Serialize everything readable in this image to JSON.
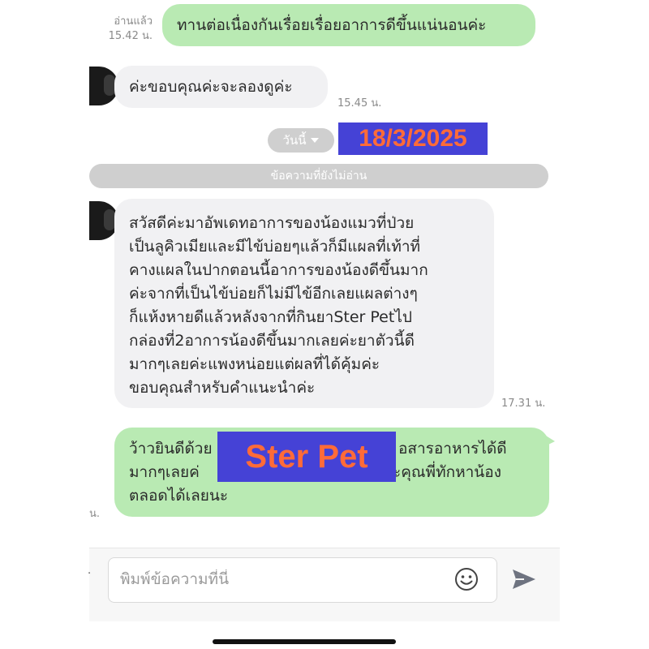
{
  "messages": {
    "m1": {
      "read_label": "อ่านแล้ว",
      "time": "15.42 น.",
      "text": "ทานต่อเนื่องกันเรื่อยเรื่อยอาการดีขึ้นแน่นอนค่ะ"
    },
    "m2": {
      "time": "15.45 น.",
      "text": "ค่ะขอบคุณค่ะจะลองดูค่ะ"
    },
    "m3": {
      "time": "17.31 น.",
      "lines": [
        "สวัสดีค่ะมาอัพเดทอาการของน้องแมวที่ป่วย",
        "เป็นลูคิวเมียและมีไข้บ่อยๆแล้วก็มีแผลที่เท้าที่",
        "คางแผลในปากตอนนี้อาการของน้องดีขึ้นมาก",
        "ค่ะจากที่เป็นไข้บ่อยก็ไม่มีไข้อีกเลยแผลต่างๆ",
        "ก็แห้งหายดีแล้วหลังจากที่กินยาSter  Petไป",
        "กล่องที่2อาการน้องดีขึ้นมากเลยค่ะยาตัวนี้ดี",
        "มากๆเลยค่ะแพงหน่อยแต่ผลที่ได้คุ้มค่ะ",
        "ขอบคุณสำหรับคำแนะนำค่ะ"
      ]
    },
    "m4": {
      "line1_left": "ว้าวยินดีด้วย",
      "line1_right": "อสารอาหารได้ดี",
      "line2_left": "มากๆเลยค่",
      "line2_right": "ะคุณพี่ทักหาน้อง",
      "line3": "ตลอดได้เลยนะ",
      "time_partial": "น."
    }
  },
  "date_separator": {
    "label": "วันนี้"
  },
  "date_overlay": "18/3/2025",
  "unread_label": "ข้อความที่ยังไม่อ่าน",
  "brand_overlay": "Ster Pet",
  "composer": {
    "placeholder": "พิมพ์ข้อความที่นี่"
  },
  "icons": {
    "emoji": "smiley-icon",
    "send": "send-arrow-icon",
    "date_caret": "chevron-down-icon"
  },
  "colors": {
    "outgoing_bubble": "#b9eab3",
    "incoming_bubble": "#f1f1f3",
    "overlay_bg": "#4542d6",
    "overlay_text": "#ff6b38",
    "pill": "#cfcfcf"
  }
}
